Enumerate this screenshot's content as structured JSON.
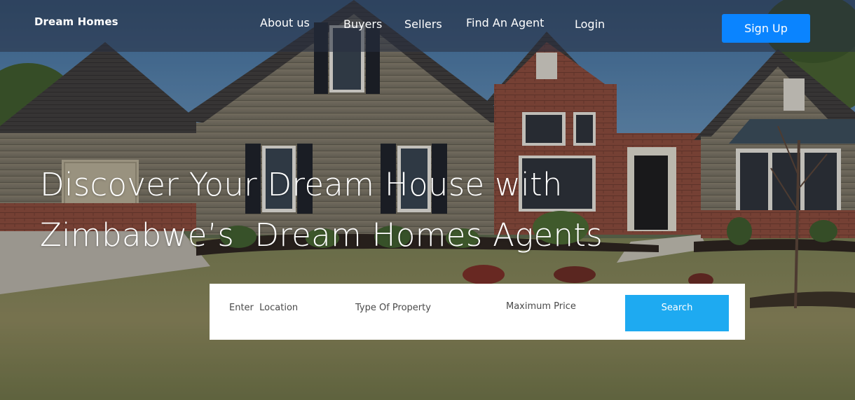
{
  "brand": {
    "name": "Dream Homes"
  },
  "nav": {
    "items": [
      {
        "label": "About us"
      },
      {
        "label": "Buyers"
      },
      {
        "label": "Sellers"
      },
      {
        "label": "Find An Agent"
      },
      {
        "label": "Login"
      }
    ],
    "signup_label": "Sign Up"
  },
  "hero": {
    "headline_line1": "Discover Your Dream House with",
    "headline_line2": "Zimbabwe’s  Dream Homes Agents"
  },
  "search": {
    "location_placeholder": "Enter  Location",
    "property_type_placeholder": "Type Of Property",
    "max_price_placeholder": "Maximum Price",
    "button_label": "Search"
  },
  "colors": {
    "accent": "#0a84ff",
    "search_button": "#1eaaf1",
    "panel": "#ffffff"
  }
}
